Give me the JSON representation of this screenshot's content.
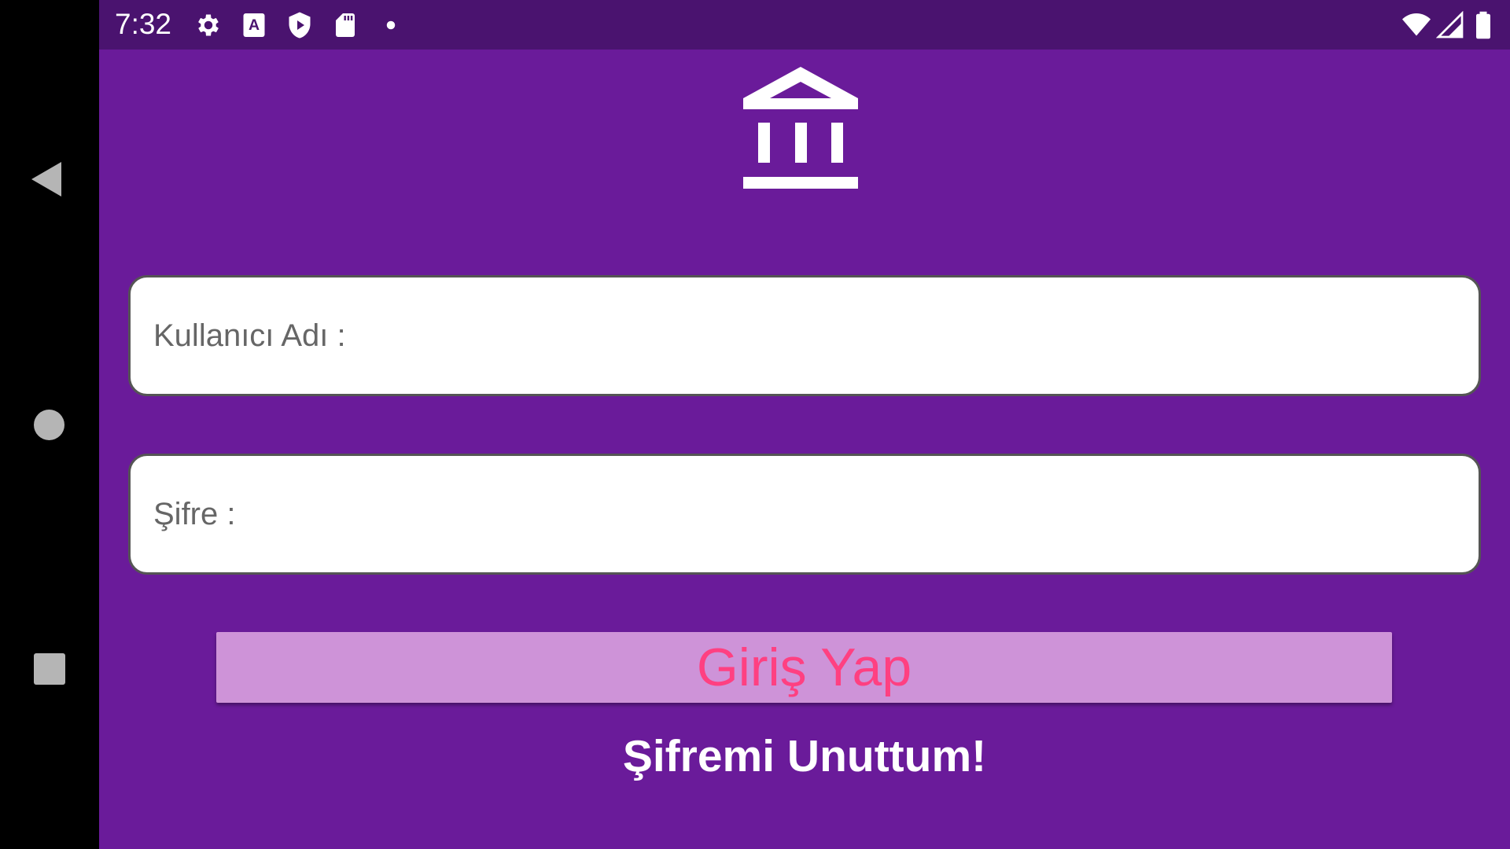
{
  "status_bar": {
    "time": "7:32",
    "left_icons": [
      "gear-icon",
      "text-a-icon",
      "play-shield-icon",
      "sd-card-icon",
      "dot-icon"
    ],
    "right_icons": [
      "wifi-icon",
      "cellular-icon",
      "battery-icon"
    ],
    "background": "#4a136f"
  },
  "navigation": {
    "icons": [
      "back-icon",
      "home-icon",
      "recents-icon"
    ]
  },
  "logo": {
    "icon": "bank-icon"
  },
  "login_form": {
    "username_placeholder": "Kullanıcı Adı :",
    "password_placeholder": "Şifre :",
    "login_button": "Giriş Yap",
    "forgot_password": "Şifremi Unuttum!"
  },
  "colors": {
    "background": "#6a1b9a",
    "button_background": "#ce93d8",
    "button_text": "#ff4081",
    "link_text": "#ffffff"
  }
}
